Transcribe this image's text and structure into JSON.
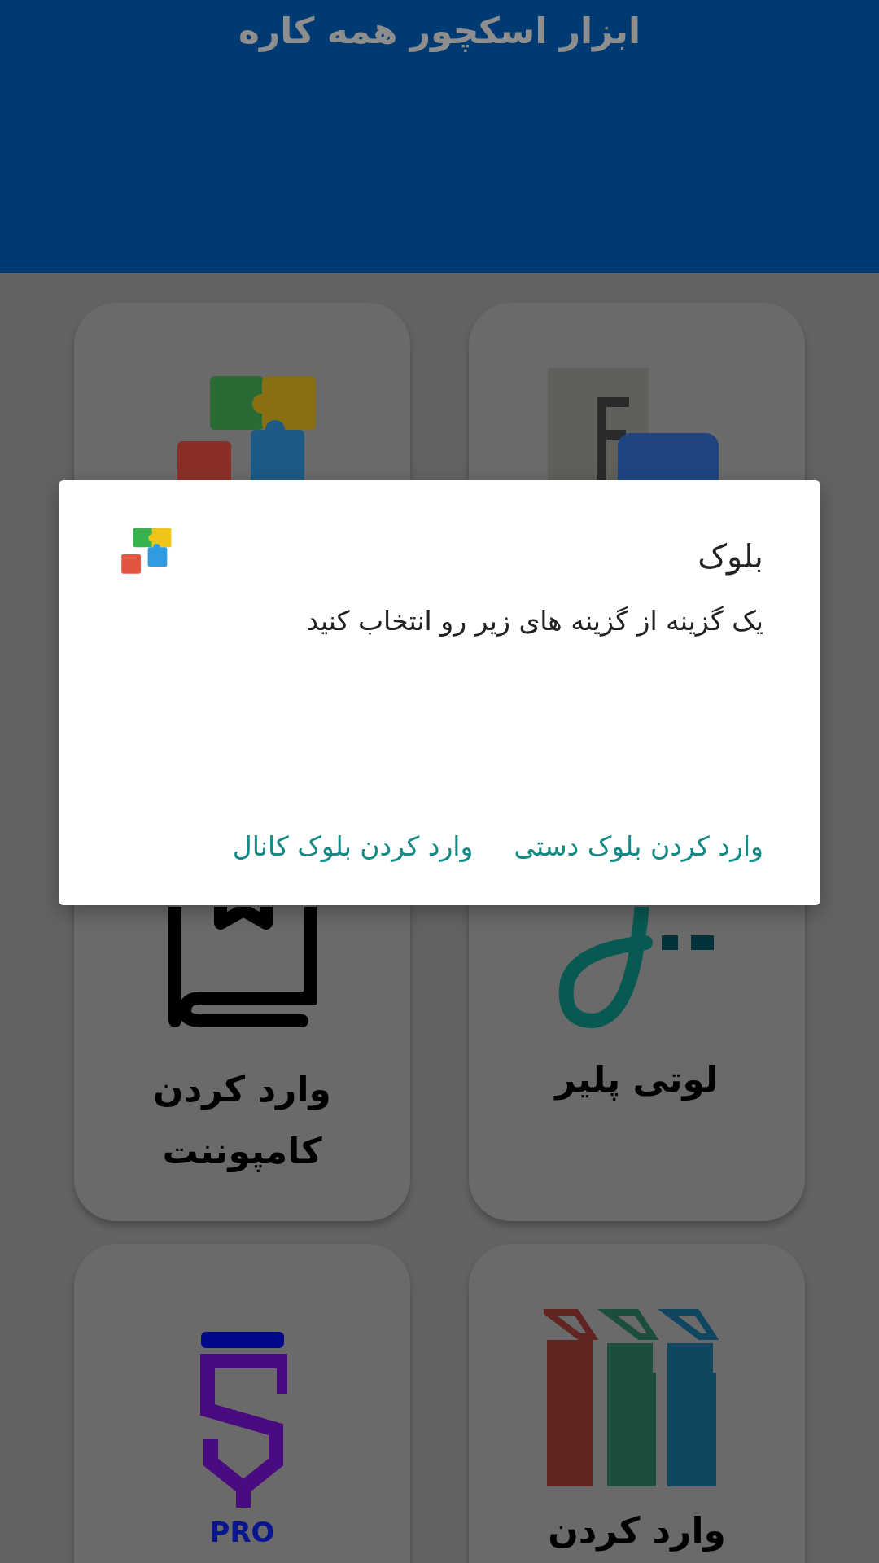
{
  "header": {
    "title": "ابزار اسکچور همه کاره"
  },
  "cards": [
    {
      "kind": "font"
    },
    {
      "kind": "puzzle"
    },
    {
      "kind": "lottie",
      "label": "لوتی پلیر"
    },
    {
      "kind": "book",
      "label": "وارد کردن کامپوننت"
    },
    {
      "kind": "books",
      "label": "وارد کردن"
    },
    {
      "kind": "pro",
      "logo_text": "PRO"
    }
  ],
  "dialog": {
    "title": "بلوک",
    "message": "یک گزینه از گزینه های زیر رو انتخاب کنید",
    "buttons": [
      "وارد کردن بلوک دستی",
      "وارد کردن بلوک کانال"
    ]
  }
}
